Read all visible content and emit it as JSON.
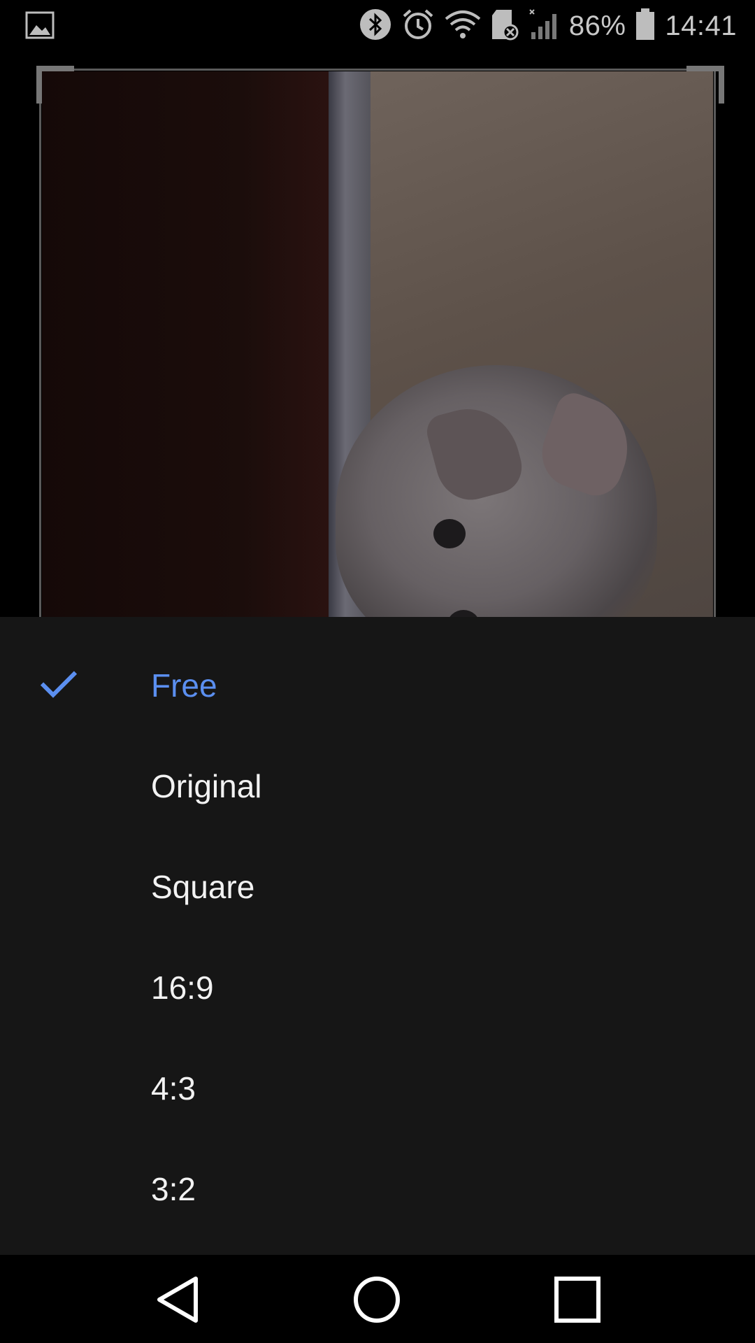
{
  "status_bar": {
    "left_icons": [
      "gallery-icon"
    ],
    "right_icons": [
      "bluetooth-icon",
      "alarm-icon",
      "wifi-icon",
      "sd-card-icon",
      "signal-icon",
      "battery-icon"
    ],
    "battery_percent": "86%",
    "battery_level": 0.86,
    "time": "14:41"
  },
  "editor": {
    "image_subject": "kitten-photo"
  },
  "aspect_menu": {
    "selected_index": 0,
    "accent_color": "#5b8ff0",
    "items": [
      {
        "label": "Free",
        "selected": true
      },
      {
        "label": "Original",
        "selected": false
      },
      {
        "label": "Square",
        "selected": false
      },
      {
        "label": "16:9",
        "selected": false
      },
      {
        "label": "4:3",
        "selected": false
      },
      {
        "label": "3:2",
        "selected": false
      }
    ]
  },
  "nav_bar": {
    "buttons": [
      "back-icon",
      "home-icon",
      "recents-icon"
    ]
  }
}
